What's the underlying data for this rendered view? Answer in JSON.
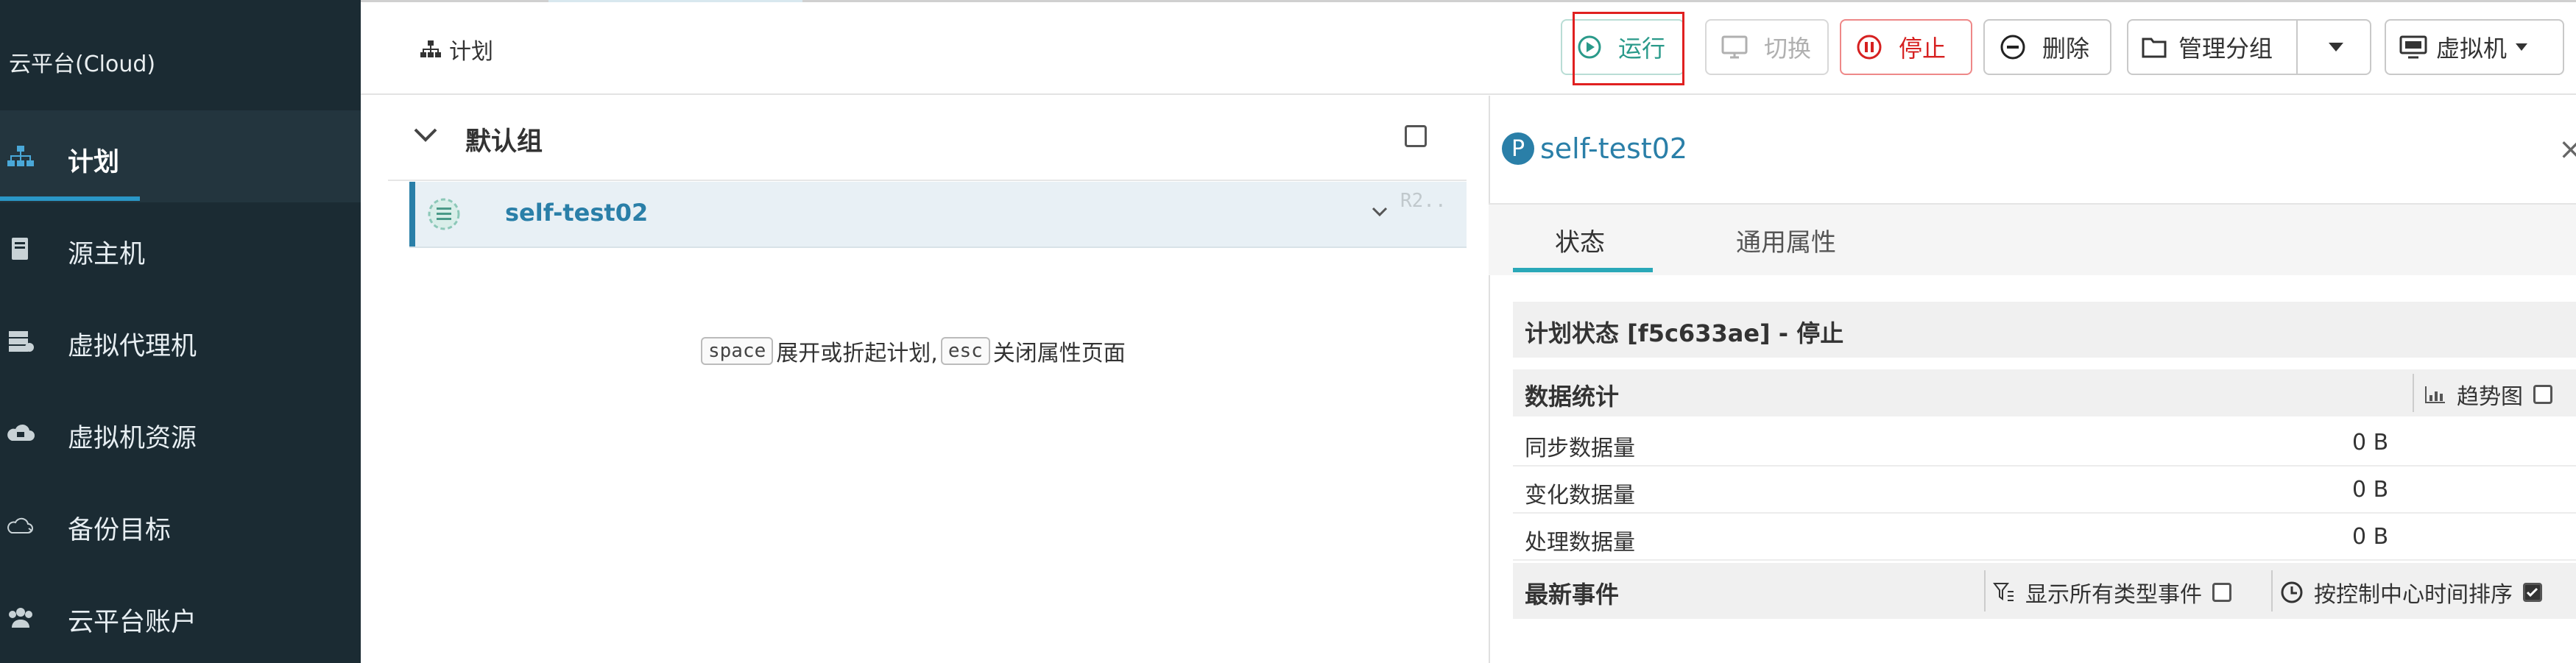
{
  "sidebar": {
    "brand": "云平台(Cloud)",
    "items": [
      {
        "label": "计划",
        "icon": "sitemap-icon",
        "active": true
      },
      {
        "label": "源主机",
        "icon": "server-icon"
      },
      {
        "label": "虚拟代理机",
        "icon": "proxy-icon"
      },
      {
        "label": "虚拟机资源",
        "icon": "cloud-icon"
      },
      {
        "label": "备份目标",
        "icon": "cloud-outline-icon"
      },
      {
        "label": "云平台账户",
        "icon": "users-icon"
      }
    ]
  },
  "header": {
    "breadcrumb": "计划",
    "toolbar": {
      "run": "运行",
      "switch": "切换",
      "stop": "停止",
      "delete": "删除",
      "manage_group": "管理分组",
      "vm": "虚拟机"
    }
  },
  "list": {
    "group_title": "默认组",
    "plan": {
      "name": "self-test02",
      "tag": "R2.."
    },
    "hint": {
      "key1": "space",
      "text1": "展开或折起计划,",
      "key2": "esc",
      "text2": "关闭属性页面"
    }
  },
  "panel": {
    "badge": "P",
    "title": "self-test02",
    "close": "×",
    "tabs": [
      "状态",
      "通用属性"
    ],
    "status_line": "计划状态 [f5c633ae]  - 停止",
    "stats": {
      "title": "数据统计",
      "trend_label": "趋势图",
      "rows": [
        {
          "key": "同步数据量",
          "value": "0 B"
        },
        {
          "key": "变化数据量",
          "value": "0 B"
        },
        {
          "key": "处理数据量",
          "value": "0 B"
        }
      ]
    },
    "events": {
      "title": "最新事件",
      "show_all": "显示所有类型事件",
      "sort_by_time": "按控制中心时间排序"
    }
  },
  "colors": {
    "sidebar_bg": "#1b2b33",
    "accent": "#2a7fa8",
    "run": "#2a9a8a",
    "stop": "#d62020"
  }
}
